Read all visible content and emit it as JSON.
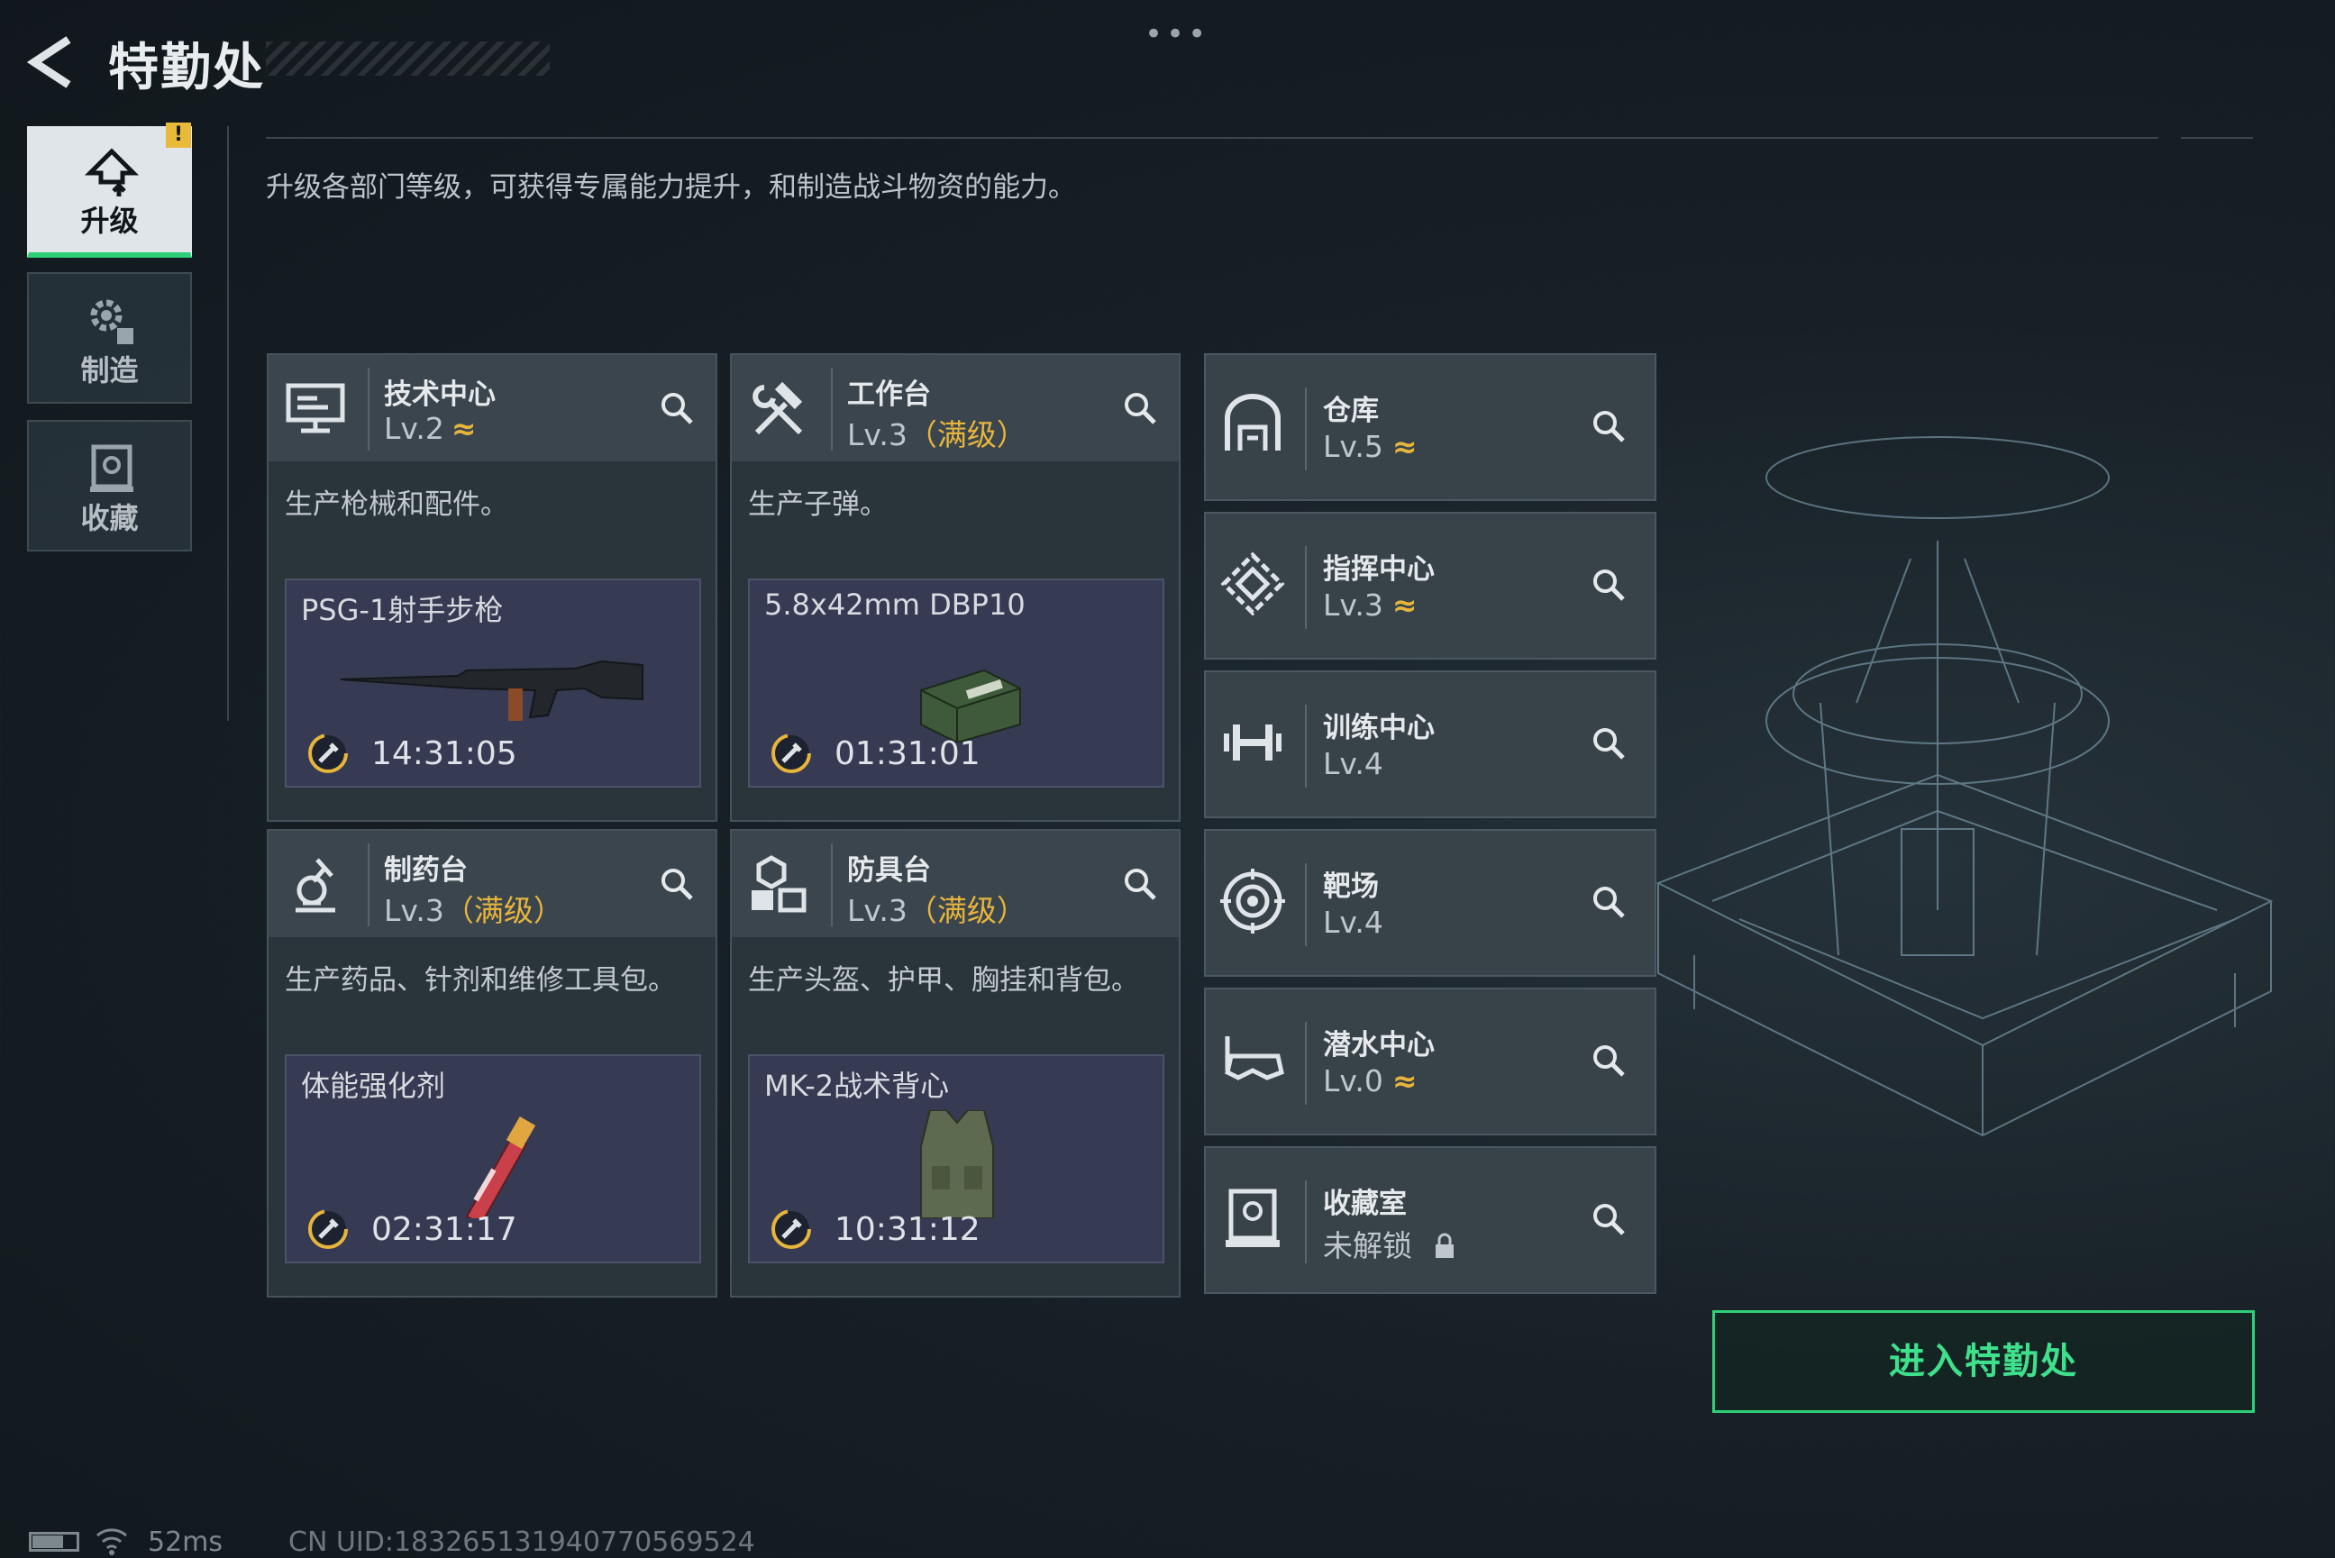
{
  "header": {
    "title": "特勤处"
  },
  "nav": {
    "alert": "!",
    "tabs": [
      {
        "label": "升级",
        "icon": "upgrade-icon",
        "active": true
      },
      {
        "label": "制造",
        "icon": "gear-icon",
        "active": false
      },
      {
        "label": "收藏",
        "icon": "collection-icon",
        "active": false
      }
    ]
  },
  "description": "升级各部门等级，可获得专属能力提升，和制造战斗物资的能力。",
  "workshops": [
    {
      "name": "技术中心",
      "level": "Lv.2",
      "maxed": "",
      "upgradable": true,
      "desc": "生产枪械和配件。",
      "item": "PSG-1射手步枪",
      "timer": "14:31:05",
      "icon": "monitor-icon",
      "item_icon": "rifle-icon"
    },
    {
      "name": "工作台",
      "level": "Lv.3",
      "maxed": "（满级）",
      "upgradable": false,
      "desc": "生产子弹。",
      "item": "5.8x42mm DBP10",
      "timer": "01:31:01",
      "icon": "hammer-wrench-icon",
      "item_icon": "ammo-box-icon"
    },
    {
      "name": "制药台",
      "level": "Lv.3",
      "maxed": "（满级）",
      "upgradable": false,
      "desc": "生产药品、针剂和维修工具包。",
      "item": "体能强化剂",
      "timer": "02:31:17",
      "icon": "microscope-icon",
      "item_icon": "injector-icon"
    },
    {
      "name": "防具台",
      "level": "Lv.3",
      "maxed": "（满级）",
      "upgradable": false,
      "desc": "生产头盔、护甲、胸挂和背包。",
      "item": "MK-2战术背心",
      "timer": "10:31:12",
      "icon": "armor-blocks-icon",
      "item_icon": "vest-icon"
    }
  ],
  "facilities": [
    {
      "name": "仓库",
      "level": "Lv.5",
      "upgradable": true,
      "icon": "warehouse-icon"
    },
    {
      "name": "指挥中心",
      "level": "Lv.3",
      "upgradable": true,
      "icon": "command-icon"
    },
    {
      "name": "训练中心",
      "level": "Lv.4",
      "upgradable": false,
      "icon": "dumbbell-icon"
    },
    {
      "name": "靶场",
      "level": "Lv.4",
      "upgradable": false,
      "icon": "target-icon"
    },
    {
      "name": "潜水中心",
      "level": "Lv.0",
      "upgradable": true,
      "icon": "dive-mask-icon"
    },
    {
      "name": "收藏室",
      "level": "未解锁",
      "upgradable": false,
      "locked": true,
      "icon": "display-case-icon"
    }
  ],
  "up_symbol": "≈",
  "enter_button": "进入特勤处",
  "status": {
    "ping": "52ms",
    "uid": "CN UID:18326513194077056952​4"
  },
  "colors": {
    "accent_green": "#2fcf77",
    "maxed_gold": "#e7b53c",
    "item_bg": "#363a52"
  }
}
